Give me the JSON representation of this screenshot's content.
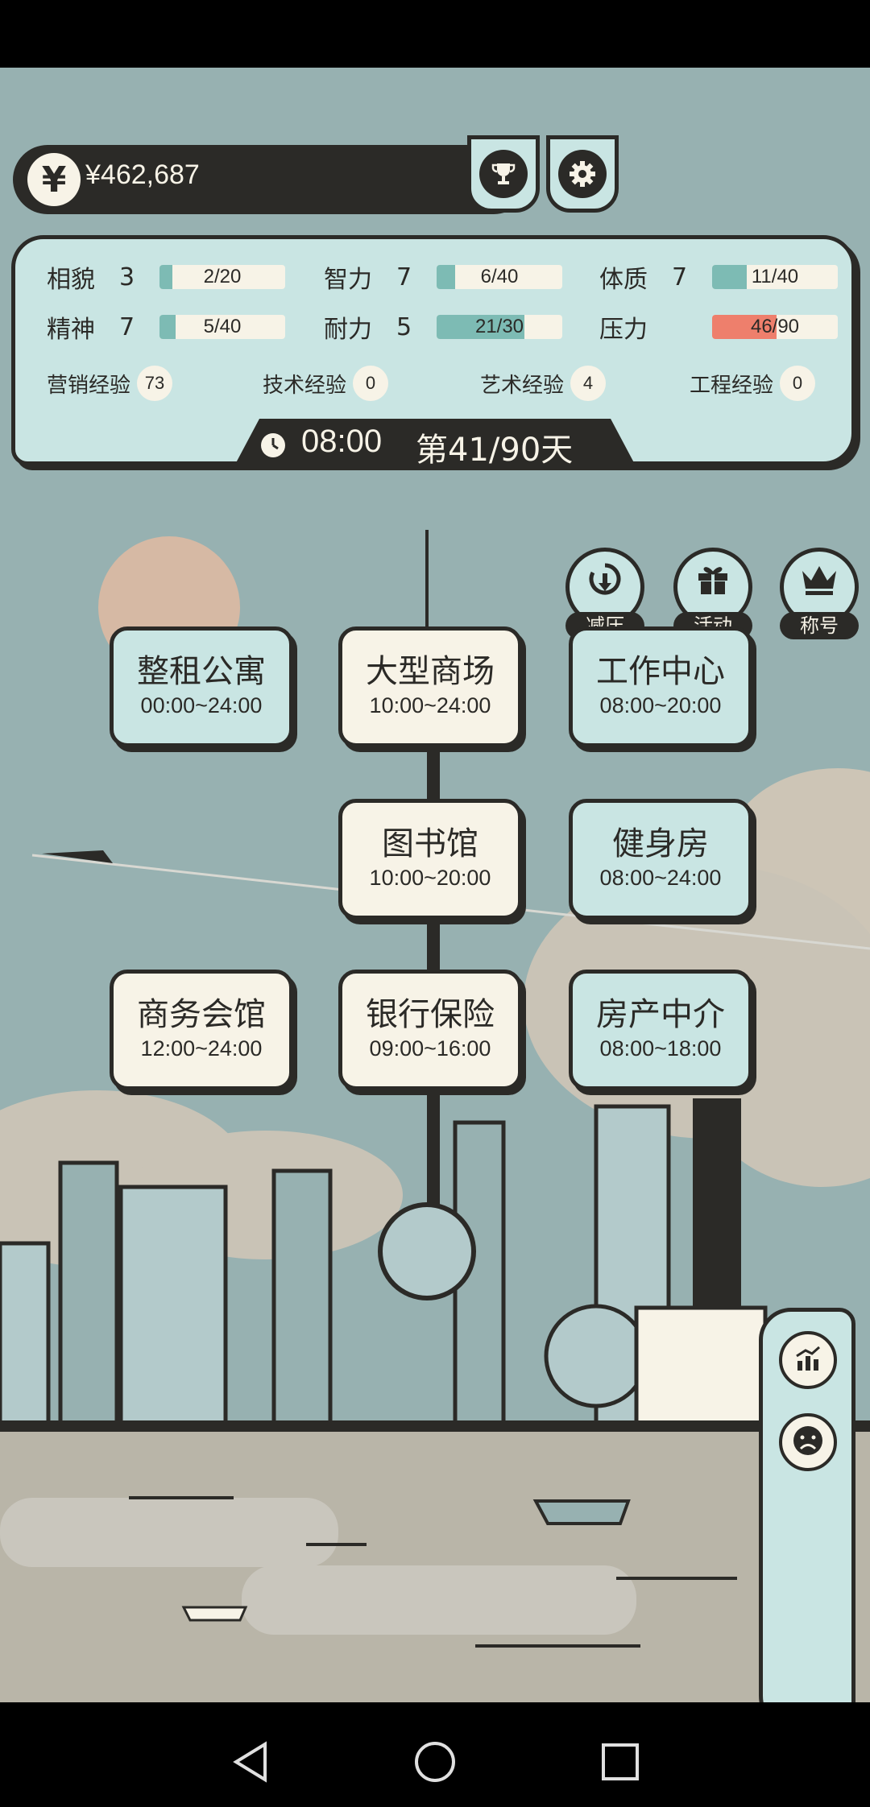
{
  "money": {
    "value": "¥462,687",
    "icon": "yen-icon"
  },
  "top_buttons": [
    {
      "name": "trophy",
      "icon": "trophy-icon"
    },
    {
      "name": "settings",
      "icon": "gear-icon"
    }
  ],
  "stats": [
    {
      "name": "相貌",
      "level": "3",
      "progress": "2/20",
      "fraction": 0.1
    },
    {
      "name": "智力",
      "level": "7",
      "progress": "6/40",
      "fraction": 0.15
    },
    {
      "name": "体质",
      "level": "7",
      "progress": "11/40",
      "fraction": 0.275
    },
    {
      "name": "精神",
      "level": "7",
      "progress": "5/40",
      "fraction": 0.125
    },
    {
      "name": "耐力",
      "level": "5",
      "progress": "21/30",
      "fraction": 0.7
    },
    {
      "name": "压力",
      "level": "",
      "progress": "46/90",
      "fraction": 0.511
    }
  ],
  "experience": [
    {
      "label": "营销经验",
      "value": "73"
    },
    {
      "label": "技术经验",
      "value": "0"
    },
    {
      "label": "艺术经验",
      "value": "4"
    },
    {
      "label": "工程经验",
      "value": "0"
    }
  ],
  "clock": {
    "time": "08:00",
    "day": "第41/90天"
  },
  "round_buttons": [
    {
      "label": "减压",
      "icon": "stress-relief-icon"
    },
    {
      "label": "活动",
      "icon": "gift-icon"
    },
    {
      "label": "称号",
      "icon": "crown-icon"
    }
  ],
  "locations": [
    {
      "name": "整租公寓",
      "hours": "00:00~24:00"
    },
    {
      "name": "大型商场",
      "hours": "10:00~24:00"
    },
    {
      "name": "工作中心",
      "hours": "08:00~20:00"
    },
    {
      "name": "图书馆",
      "hours": "10:00~20:00"
    },
    {
      "name": "健身房",
      "hours": "08:00~24:00"
    },
    {
      "name": "商务会馆",
      "hours": "12:00~24:00"
    },
    {
      "name": "银行保险",
      "hours": "09:00~16:00"
    },
    {
      "name": "房产中介",
      "hours": "08:00~18:00"
    }
  ],
  "side_buttons": [
    {
      "icon": "chart-icon"
    },
    {
      "icon": "sad-face-icon"
    }
  ],
  "nav": [
    {
      "icon": "back-icon"
    },
    {
      "icon": "home-icon"
    },
    {
      "icon": "recents-icon"
    }
  ],
  "colors": {
    "panel": "#c9e5e3",
    "ink": "#2b2a27",
    "cream": "#f7f3e7",
    "bar_fill": "#7dbbb4",
    "stress_fill": "#ee7f6c",
    "sky": "#97b1b1"
  }
}
